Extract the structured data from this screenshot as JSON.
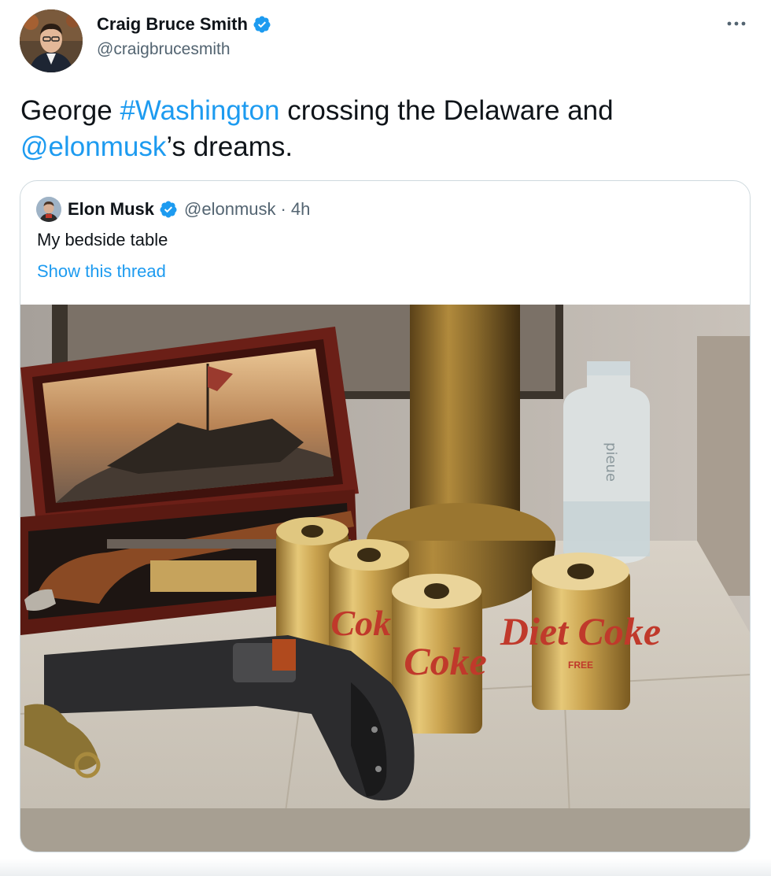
{
  "tweet": {
    "author_name": "Craig Bruce Smith",
    "author_handle": "@craigbrucesmith",
    "text_1": "George ",
    "hashtag": "#Washington",
    "text_2": " crossing the Delaware and ",
    "mention": "@elonmusk",
    "text_3": "’s dreams."
  },
  "quoted": {
    "author_name": "Elon Musk",
    "author_handle": "@elonmusk",
    "separator": "·",
    "time": "4h",
    "text": "My bedside table",
    "thread_link": "Show this thread",
    "image_can_labels": [
      "Coke",
      "Coke",
      "Diet Coke",
      "FREE"
    ],
    "image_bottle_label": "pieue"
  },
  "icons": {
    "verified": "verified-badge-icon",
    "more": "more-horizontal-icon"
  },
  "colors": {
    "accent": "#1d9bf0",
    "secondary_text": "#536471",
    "border": "#cfd9de"
  }
}
